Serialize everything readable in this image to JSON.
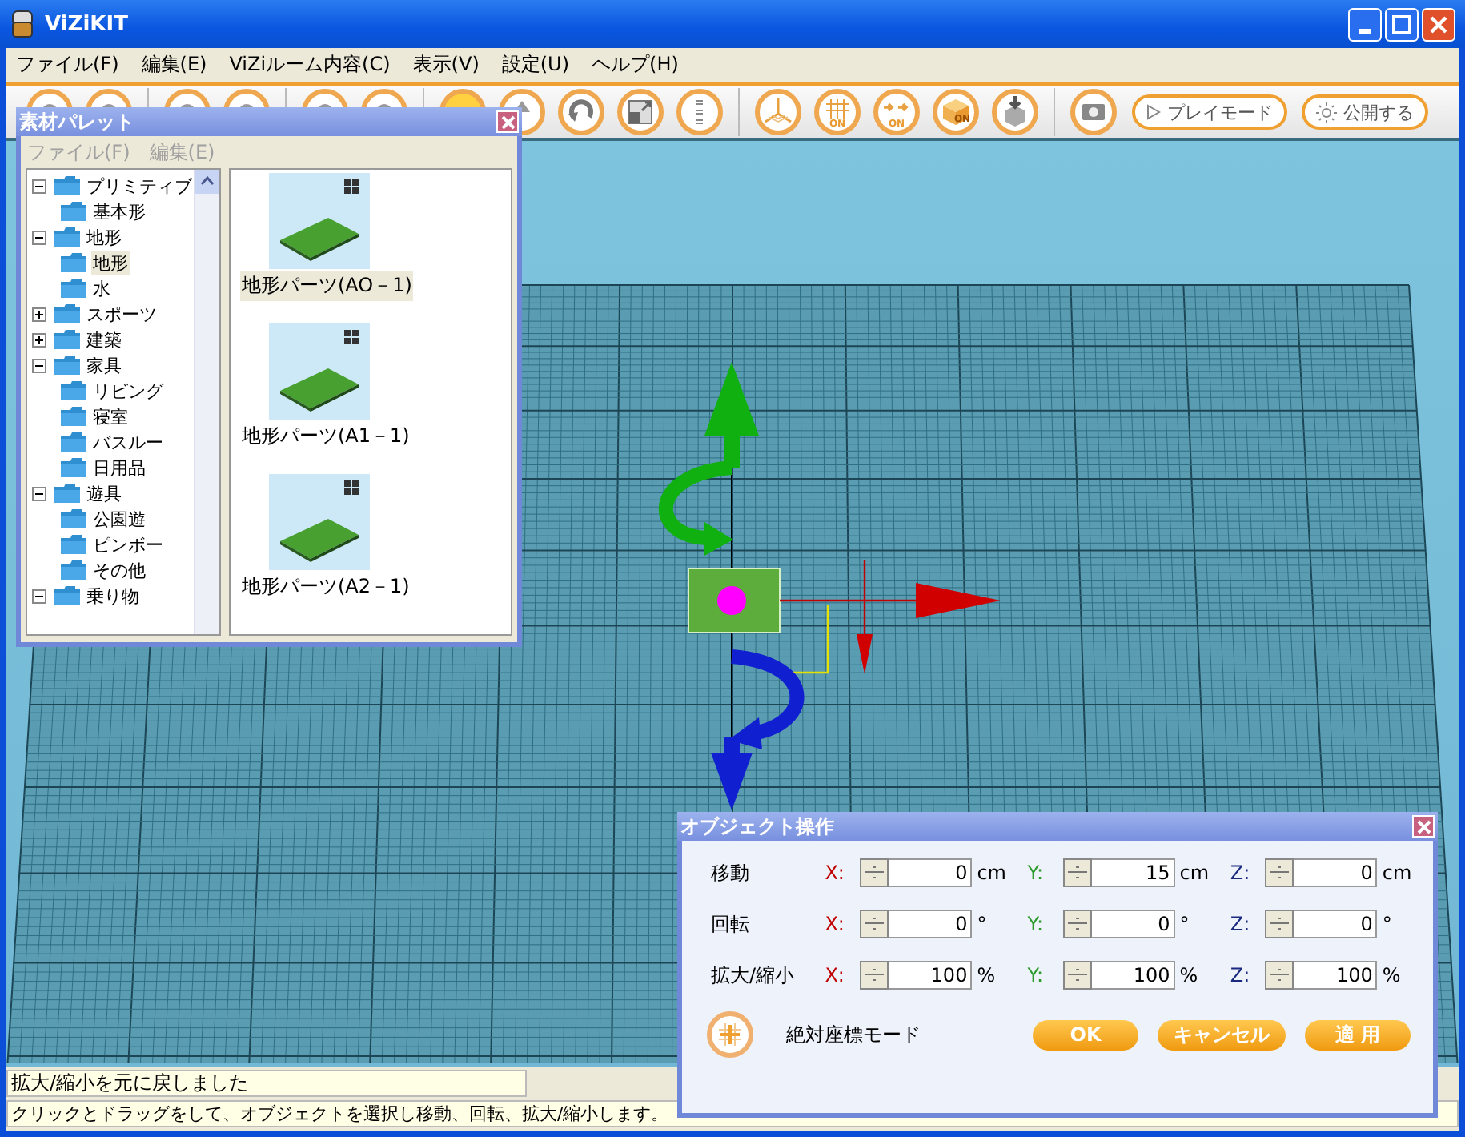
{
  "window": {
    "title": "ViZiKIT"
  },
  "menu": [
    "ファイル(F)",
    "編集(E)",
    "ViZiルーム内容(C)",
    "表示(V)",
    "設定(U)",
    "ヘルプ(H)"
  ],
  "toolbar": {
    "toggle_captions": [
      "ON",
      "ON",
      "ON"
    ],
    "buttons": [
      {
        "label": "プレイモード"
      },
      {
        "label": "公開する"
      }
    ]
  },
  "palette": {
    "title": "素材パレット",
    "menu": [
      {
        "label": "ファイル(F)",
        "disabled": true
      },
      {
        "label": "編集(E)",
        "disabled": true
      }
    ],
    "tree": [
      {
        "label": "プリミティブ",
        "expanded": true,
        "selected": false,
        "children": [
          {
            "label": "基本形",
            "selected": false
          }
        ]
      },
      {
        "label": "地形",
        "expanded": true,
        "selected": false,
        "children": [
          {
            "label": "地形",
            "selected": true
          },
          {
            "label": "水",
            "selected": false
          }
        ]
      },
      {
        "label": "スポーツ",
        "expanded": false,
        "selected": false
      },
      {
        "label": "建築",
        "expanded": false,
        "selected": false
      },
      {
        "label": "家具",
        "expanded": true,
        "selected": false,
        "children": [
          {
            "label": "リビング",
            "selected": false
          },
          {
            "label": "寝室",
            "selected": false
          },
          {
            "label": "バスルー",
            "selected": false
          },
          {
            "label": "日用品",
            "selected": false
          }
        ]
      },
      {
        "label": "遊具",
        "expanded": true,
        "selected": false,
        "children": [
          {
            "label": "公園遊",
            "selected": false
          },
          {
            "label": "ピンボー",
            "selected": false
          },
          {
            "label": "その他",
            "selected": false
          }
        ]
      },
      {
        "label": "乗り物",
        "expanded": true,
        "selected": false
      }
    ],
    "items": [
      {
        "label": "地形パーツ(AO－1)",
        "selected": true
      },
      {
        "label": "地形パーツ(A1－1)",
        "selected": false
      },
      {
        "label": "地形パーツ(A2－1)",
        "selected": false
      }
    ]
  },
  "dialog": {
    "title": "オブジェクト操作",
    "rows": [
      {
        "label": "移動",
        "fields": [
          {
            "axis": "X:",
            "color": "#c00000",
            "value": "0",
            "unit": "cm"
          },
          {
            "axis": "Y:",
            "color": "#2a9a2a",
            "value": "15",
            "unit": "cm"
          },
          {
            "axis": "Z:",
            "color": "#1a2a80",
            "value": "0",
            "unit": "cm"
          }
        ]
      },
      {
        "label": "回転",
        "fields": [
          {
            "axis": "X:",
            "color": "#c00000",
            "value": "0",
            "unit": "°"
          },
          {
            "axis": "Y:",
            "color": "#2a9a2a",
            "value": "0",
            "unit": "°"
          },
          {
            "axis": "Z:",
            "color": "#1a2a80",
            "value": "0",
            "unit": "°"
          }
        ]
      },
      {
        "label": "拡大/縮小",
        "fields": [
          {
            "axis": "X:",
            "color": "#c00000",
            "value": "100",
            "unit": "%"
          },
          {
            "axis": "Y:",
            "color": "#2a9a2a",
            "value": "100",
            "unit": "%"
          },
          {
            "axis": "Z:",
            "color": "#1a2a80",
            "value": "100",
            "unit": "%"
          }
        ]
      }
    ],
    "mode_label": "絶対座標モード",
    "buttons": [
      "OK",
      "キャンセル",
      "適 用"
    ]
  },
  "status": [
    "拡大/縮小を元に戻しました",
    "クリックとドラッグをして、オブジェクトを選択し移動、回転、拡大/縮小します。"
  ]
}
